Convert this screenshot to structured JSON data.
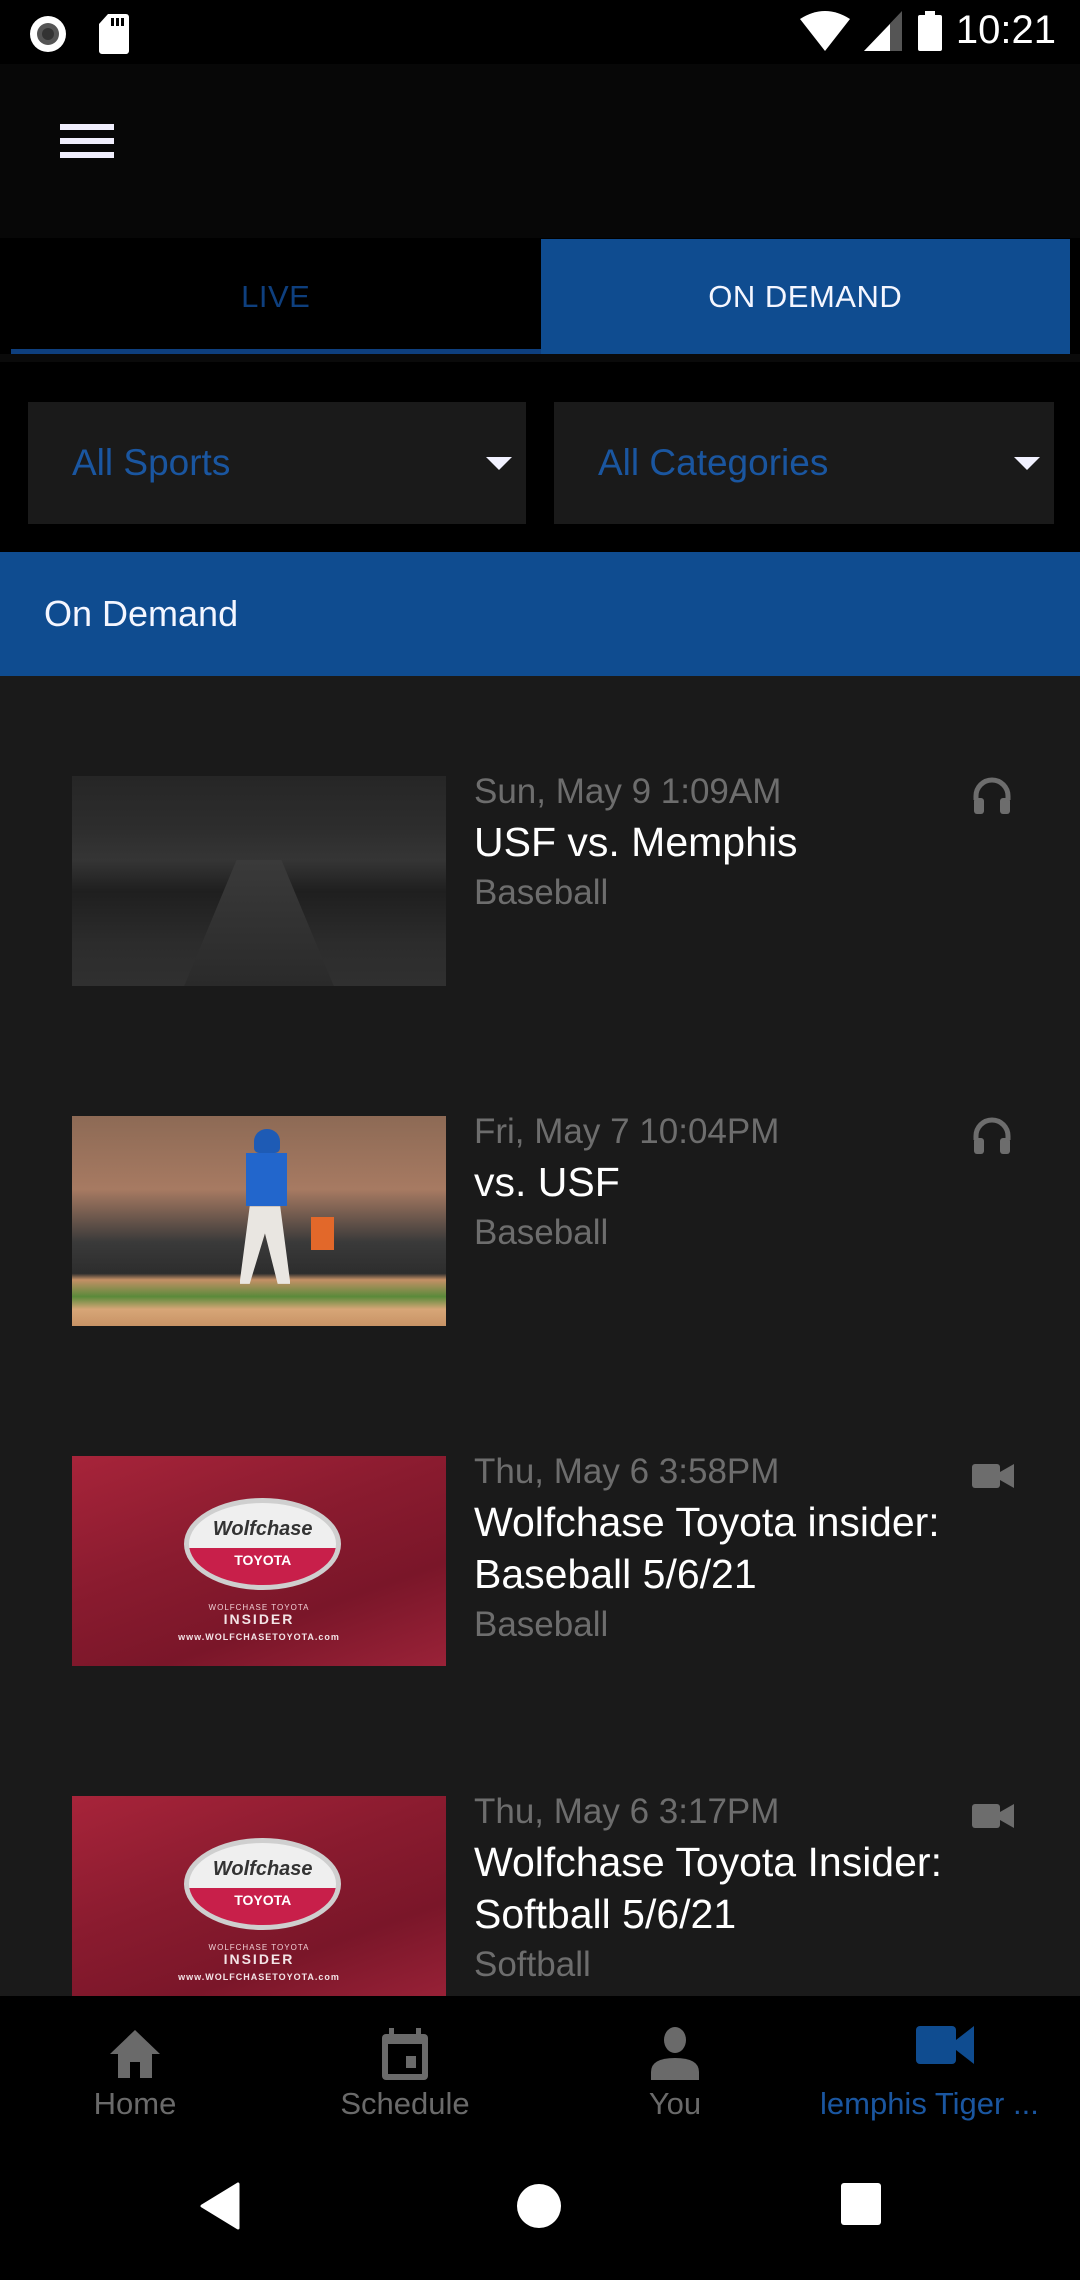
{
  "status_bar": {
    "time": "10:21",
    "left_icons": [
      "record-icon",
      "sd-card-icon"
    ],
    "right_icons": [
      "wifi-icon",
      "cell-signal-icon",
      "battery-icon"
    ]
  },
  "header": {
    "menu_icon": "hamburger-menu-icon"
  },
  "tabs": [
    {
      "label": "LIVE",
      "selected": false
    },
    {
      "label": "ON DEMAND",
      "selected": true
    }
  ],
  "filters": {
    "sports": {
      "selected": "All Sports"
    },
    "categories": {
      "selected": "All Categories"
    }
  },
  "section": {
    "title": "On Demand"
  },
  "items": [
    {
      "date": "Sun, May 9 1:09AM",
      "title": "USF vs. Memphis",
      "sport": "Baseball",
      "media_type": "audio",
      "media_icon": "headphones-icon",
      "thumbnail": "stadium-walkway-image"
    },
    {
      "date": "Fri, May 7 10:04PM",
      "title": "vs. USF",
      "sport": "Baseball",
      "media_type": "audio",
      "media_icon": "headphones-icon",
      "thumbnail": "baseball-player-running-image"
    },
    {
      "date": "Thu, May 6 3:58PM",
      "title": "Wolfchase Toyota insider: Baseball 5/6/21",
      "sport": "Baseball",
      "media_type": "video",
      "media_icon": "video-camera-icon",
      "thumbnail": "wolfchase-toyota-insider-image",
      "thumb_text": {
        "brand": "Wolfchase",
        "make": "TOYOTA",
        "cap1": "WOLFCHASE TOYOTA",
        "cap2": "INSIDER",
        "cap3": "www.WOLFCHASETOYOTA.com"
      }
    },
    {
      "date": "Thu, May 6 3:17PM",
      "title": "Wolfchase Toyota Insider: Softball 5/6/21",
      "sport": "Softball",
      "media_type": "video",
      "media_icon": "video-camera-icon",
      "thumbnail": "wolfchase-toyota-insider-image",
      "thumb_text": {
        "brand": "Wolfchase",
        "make": "TOYOTA",
        "cap1": "WOLFCHASE TOYOTA",
        "cap2": "INSIDER",
        "cap3": "www.WOLFCHASETOYOTA.com"
      }
    }
  ],
  "bottom_nav": [
    {
      "label": "Home",
      "icon": "home-icon",
      "active": false
    },
    {
      "label": "Schedule",
      "icon": "calendar-icon",
      "active": false
    },
    {
      "label": "You",
      "icon": "person-icon",
      "active": false
    },
    {
      "label": "Memphis Tiger ...",
      "visible_label": "lemphis Tiger ...",
      "icon": "video-camera-icon",
      "active": true
    }
  ],
  "system_nav": [
    "back-button",
    "home-button",
    "recents-button"
  ],
  "colors": {
    "accent": "#0f4c90",
    "accent_text": "#1a56a0",
    "background": "#000000",
    "list_background": "#1a1a1a",
    "muted_text": "#6d6d6d"
  }
}
